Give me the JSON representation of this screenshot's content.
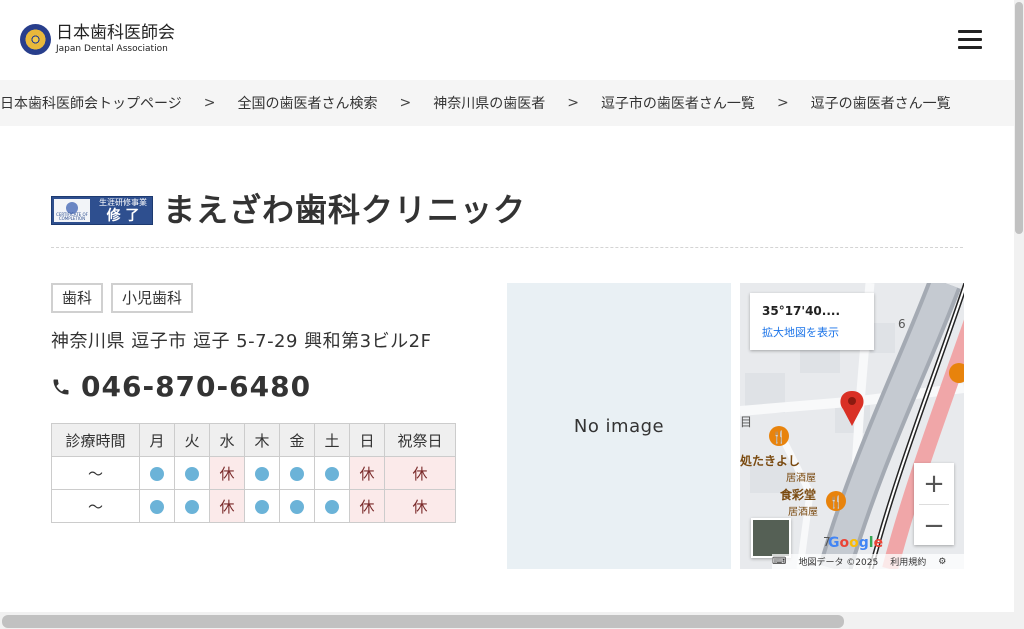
{
  "header": {
    "logo_jp": "日本歯科医師会",
    "logo_en": "Japan Dental Association"
  },
  "breadcrumb": [
    "日本歯科医師会トップページ",
    "全国の歯医者さん検索",
    "神奈川県の歯医者",
    "逗子市の歯医者さん一覧",
    "逗子の歯医者さん一覧"
  ],
  "breadcrumb_separator": ">",
  "badge": {
    "top": "生涯研修事業",
    "main": "修 了",
    "seal": "CERTIFICATE OF COMPLETION"
  },
  "clinic": {
    "name": "まえざわ歯科クリニック",
    "tags": [
      "歯科",
      "小児歯科"
    ],
    "address": "神奈川県 逗子市 逗子 5-7-29 興和第3ビル2F",
    "phone": "046-870-6480"
  },
  "hours": {
    "headers": [
      "診療時間",
      "月",
      "火",
      "水",
      "木",
      "金",
      "土",
      "日",
      "祝祭日"
    ],
    "rows": [
      {
        "time": "〜",
        "days": [
          "open",
          "open",
          "休",
          "open",
          "open",
          "open",
          "休",
          "休"
        ]
      },
      {
        "time": "〜",
        "days": [
          "open",
          "open",
          "休",
          "open",
          "open",
          "open",
          "休",
          "休"
        ]
      }
    ]
  },
  "no_image_text": "No image",
  "map": {
    "coord": "35°17'40....",
    "link": "拡大地図を表示",
    "place1": "処たきよし",
    "place1_sub": "居酒屋",
    "place2": "食彩堂",
    "place2_sub": "居酒屋",
    "label_6": "6",
    "label_7": "7",
    "label_me": "目",
    "zoom_in": "+",
    "zoom_out": "−",
    "attribution": "地図データ ©2025",
    "terms": "利用規約",
    "google": "Google"
  }
}
